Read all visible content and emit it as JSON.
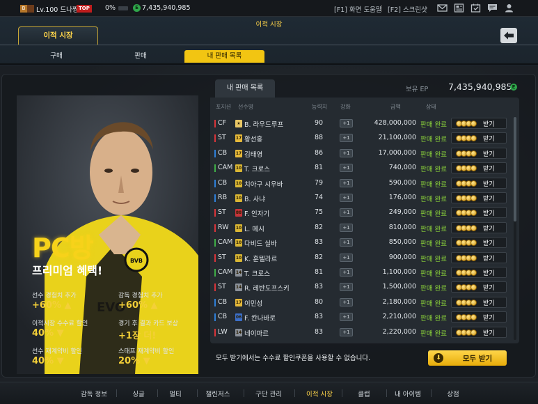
{
  "topbar": {
    "level": "Lv.100 드나짱",
    "top_badge": "TOP",
    "exp_percent": "0%",
    "ep": "7,435,940,985",
    "help_f1": "[F1] 화면 도움말",
    "help_f2": "[F2] 스크린샷",
    "icons": [
      "mail-icon",
      "news-icon",
      "calendar-icon",
      "chat-icon",
      "profile-icon"
    ]
  },
  "header": {
    "title": "이적 시장",
    "main_tab": "이적 시장",
    "subtabs": [
      "구매",
      "판매",
      "내 판매 목록"
    ],
    "active_subtab": 2
  },
  "promo": {
    "pc": "PC방",
    "subtitle": "프리미엄 혜택!",
    "stats": [
      {
        "label": "선수 경험치 추가",
        "value": "+60% ▲"
      },
      {
        "label": "감독 경험치 추가",
        "value": "+60% ▲"
      },
      {
        "label": "이적시장 수수료 할인",
        "value": "40% ▼"
      },
      {
        "label": "경기 후 결과 카드 보상",
        "value": "+1장 더!"
      },
      {
        "label": "선수 재계약비 할인",
        "value": "40% ▼"
      },
      {
        "label": "스태프 재계약비 할인",
        "value": "20% ▼"
      }
    ]
  },
  "sales": {
    "tab_label": "내 판매 목록",
    "ep_label": "보유 EP",
    "ep_value": "7,435,940,985",
    "columns": {
      "position": "포지션",
      "player": "선수명",
      "ovr": "능력치",
      "upgrade": "강화",
      "price": "금액",
      "status": "상태"
    },
    "rows": [
      {
        "pos": "CF",
        "pos_color": "#d8353a",
        "card": "★",
        "card_color": "#e9c766",
        "name": "B. 라우드루프",
        "ovr": "90",
        "upg": "+1",
        "price": "428,000,000",
        "status": "판매 완료",
        "recv": "받기"
      },
      {
        "pos": "ST",
        "pos_color": "#d8353a",
        "card": "17",
        "card_color": "#e6b93a",
        "name": "황선홍",
        "ovr": "88",
        "upg": "+1",
        "price": "21,100,000",
        "status": "판매 완료",
        "recv": "받기"
      },
      {
        "pos": "CB",
        "pos_color": "#2f7fd8",
        "card": "17",
        "card_color": "#e6b93a",
        "name": "김태영",
        "ovr": "86",
        "upg": "+1",
        "price": "17,000,000",
        "status": "판매 완료",
        "recv": "받기"
      },
      {
        "pos": "CAM",
        "pos_color": "#3fae47",
        "card": "10",
        "card_color": "#d9b634",
        "name": "T. 크로스",
        "ovr": "81",
        "upg": "+1",
        "price": "740,000",
        "status": "판매 완료",
        "recv": "받기"
      },
      {
        "pos": "CB",
        "pos_color": "#2f7fd8",
        "card": "10",
        "card_color": "#d9b634",
        "name": "치아구 시우바",
        "ovr": "79",
        "upg": "+1",
        "price": "590,000",
        "status": "판매 완료",
        "recv": "받기"
      },
      {
        "pos": "RB",
        "pos_color": "#2f7fd8",
        "card": "10",
        "card_color": "#d9b634",
        "name": "B. 사냐",
        "ovr": "74",
        "upg": "+1",
        "price": "176,000",
        "status": "판매 완료",
        "recv": "받기"
      },
      {
        "pos": "ST",
        "pos_color": "#d8353a",
        "card": "88",
        "card_color": "#c6343a",
        "name": "F. 인자기",
        "ovr": "75",
        "upg": "+1",
        "price": "249,000",
        "status": "판매 완료",
        "recv": "받기"
      },
      {
        "pos": "RW",
        "pos_color": "#d8353a",
        "card": "10",
        "card_color": "#d9b634",
        "name": "L. 메시",
        "ovr": "82",
        "upg": "+1",
        "price": "810,000",
        "status": "판매 완료",
        "recv": "받기"
      },
      {
        "pos": "CAM",
        "pos_color": "#3fae47",
        "card": "10",
        "card_color": "#d9b634",
        "name": "다비드 실바",
        "ovr": "83",
        "upg": "+1",
        "price": "850,000",
        "status": "판매 완료",
        "recv": "받기"
      },
      {
        "pos": "ST",
        "pos_color": "#d8353a",
        "card": "10",
        "card_color": "#d9b634",
        "name": "K. 훈텔라르",
        "ovr": "82",
        "upg": "+1",
        "price": "900,000",
        "status": "판매 완료",
        "recv": "받기"
      },
      {
        "pos": "CAM",
        "pos_color": "#3fae47",
        "card": "14",
        "card_color": "#8a9099",
        "name": "T. 크로스",
        "ovr": "81",
        "upg": "+1",
        "price": "1,100,000",
        "status": "판매 완료",
        "recv": "받기"
      },
      {
        "pos": "ST",
        "pos_color": "#d8353a",
        "card": "14",
        "card_color": "#8a9099",
        "name": "R. 레반도프스키",
        "ovr": "83",
        "upg": "+1",
        "price": "1,500,000",
        "status": "판매 완료",
        "recv": "받기"
      },
      {
        "pos": "CB",
        "pos_color": "#2f7fd8",
        "card": "17",
        "card_color": "#e6b93a",
        "name": "이민성",
        "ovr": "80",
        "upg": "+1",
        "price": "2,180,000",
        "status": "판매 완료",
        "recv": "받기"
      },
      {
        "pos": "CB",
        "pos_color": "#2f7fd8",
        "card": "06",
        "card_color": "#3b6fc9",
        "name": "F. 칸나바로",
        "ovr": "83",
        "upg": "+1",
        "price": "2,210,000",
        "status": "판매 완료",
        "recv": "받기"
      },
      {
        "pos": "LW",
        "pos_color": "#d8353a",
        "card": "14",
        "card_color": "#8a9099",
        "name": "네이마르",
        "ovr": "83",
        "upg": "+1",
        "price": "2,220,000",
        "status": "판매 완료",
        "recv": "받기"
      }
    ],
    "notice": "모두 받기에서는 수수료 할인쿠폰을 사용할 수 없습니다.",
    "receive_all": "모두 받기"
  },
  "bottom_nav": {
    "items": [
      "감독 정보",
      "싱글",
      "멀티",
      "챌린저스",
      "구단 관리",
      "이적 시장",
      "클럽",
      "내 아이템",
      "상점"
    ],
    "active": 5
  }
}
